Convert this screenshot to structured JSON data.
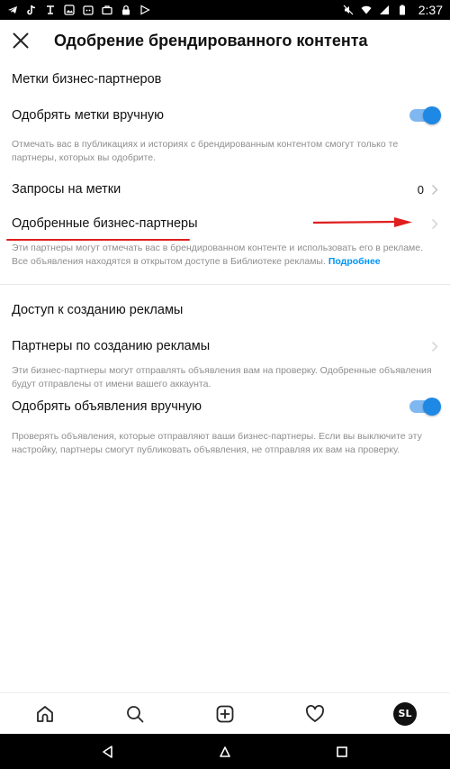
{
  "status_bar": {
    "time": "2:37",
    "left_icons": [
      "telegram-icon",
      "tiktok-icon",
      "text-icon",
      "image-icon",
      "android-icon",
      "briefcase-icon",
      "lock-icon",
      "play-store-icon"
    ],
    "right_icons": [
      "mute-icon",
      "wifi-icon",
      "signal-icon",
      "battery-icon"
    ]
  },
  "header": {
    "title": "Одобрение брендированного контента"
  },
  "section_partner_tags": {
    "title": "Метки бизнес-партнеров",
    "approve_manually": {
      "label": "Одобрять метки вручную",
      "toggle_on": true,
      "description": "Отмечать вас в публикациях и историях с брендированным контентом смогут только те партнеры, которых вы одобрите."
    },
    "tag_requests": {
      "label": "Запросы на метки",
      "count": "0"
    },
    "approved_partners": {
      "label": "Одобренные бизнес-партнеры",
      "description": "Эти партнеры могут отмечать вас в брендированном контенте и использовать его в рекламе. Все объявления находятся в открытом доступе в Библиотеке рекламы.",
      "link": "Подробнее"
    }
  },
  "section_ad_creation": {
    "title": "Доступ к созданию рекламы",
    "ad_partners": {
      "label": "Партнеры по созданию рекламы",
      "description": "Эти бизнес-партнеры могут отправлять объявления вам на проверку. Одобренные объявления будут отправлены от имени вашего аккаунта."
    },
    "approve_ads": {
      "label": "Одобрять объявления вручную",
      "toggle_on": true,
      "description": "Проверять объявления, которые отправляют ваши бизнес-партнеры. Если вы выключите эту настройку, партнеры смогут публиковать объявления, не отправляя их вам на проверку."
    }
  },
  "bottom_nav": {
    "items": [
      "home-icon",
      "search-icon",
      "create-icon",
      "activity-icon",
      "profile-avatar"
    ],
    "avatar_initials": "SL"
  },
  "android_nav": [
    "back-icon",
    "home-icon",
    "recents-icon"
  ],
  "colors": {
    "accent": "#0095f6",
    "toggle_track": "#7fb8f0",
    "toggle_knob": "#1e88e5",
    "annotation_red": "#e01e1e"
  }
}
